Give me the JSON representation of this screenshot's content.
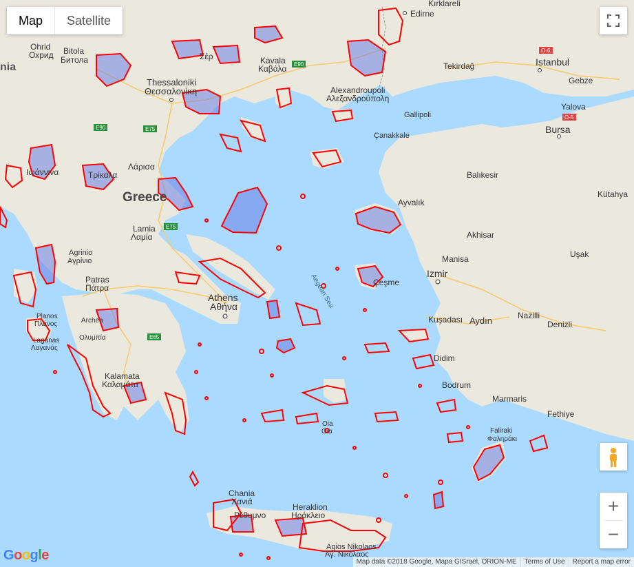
{
  "map_type": {
    "map": "Map",
    "satellite": "Satellite"
  },
  "labels": {
    "edirne": "Edirne",
    "kirklareli": "Kırklareli",
    "ohrid": "Ohrid",
    "ohrid_cyr": "Охрид",
    "bitola": "Bitola",
    "bitola_cyr": "Битола",
    "serres_partial": "Σέρ",
    "kavala": "Kavala",
    "kavala_gr": "Καβάλα",
    "thessaloniki": "Thessaloniki",
    "thessaloniki_gr": "Θεσσαλονίκη",
    "alexandroupoli": "Alexandroupoli",
    "alexandroupoli_gr": "Αλεξανδρούπολη",
    "tekirdag": "Tekirdağ",
    "istanbul": "Istanbul",
    "gebze": "Gebze",
    "yalova": "Yalova",
    "bursa": "Bursa",
    "gallipoli": "Gallipoli",
    "canakkale": "Çanakkale",
    "balikesir": "Balıkesir",
    "kutahya": "Kütahya",
    "ioannina_gr": "Ιωάννινα",
    "trikala_gr": "Τρίκαλα",
    "larissa_gr": "Λάρισα",
    "greece": "Greece",
    "lamia": "Lamia",
    "lamia_gr": "Λαμία",
    "ayvalik": "Ayvalık",
    "akhisar": "Akhisar",
    "manisa": "Manisa",
    "usak": "Uşak",
    "izmir": "Izmir",
    "cesme": "Çeşme",
    "agrinio": "Agrinio",
    "agrinio_gr": "Αγρίνιο",
    "patras": "Patras",
    "patras_gr": "Πάτρα",
    "athens": "Athens",
    "athens_gr": "Αθήνα",
    "aegean_sea": "Aegean Sea",
    "kusadasi": "Kuşadası",
    "aydin": "Aydın",
    "nazilli": "Nazilli",
    "denizli": "Denizli",
    "planos": "Planos",
    "planos_gr": "Πλάνος",
    "laganas": "Laganas",
    "laganas_gr": "Λαγανάς",
    "archea": "Archea",
    "olympia_gr": "Ολυμπία",
    "didim": "Didim",
    "bodrum": "Bodrum",
    "marmaris": "Marmaris",
    "fethiye": "Fethiye",
    "kalamata": "Kalamata",
    "kalamata_gr": "Καλαμάτα",
    "oia": "Oia",
    "oia_gr": "Οία",
    "faliraki": "Faliraki",
    "faliraki_gr": "Φαληράκι",
    "chania": "Chania",
    "chania_gr": "Χανιά",
    "rethymno_gr": "Ρέθυμνο",
    "heraklion": "Heraklion",
    "heraklion_gr": "Ηράκλειο",
    "agios_nikolaos": "Agios Nikolaos",
    "agios_nikolaos_gr": "Αγ. Νικόλαος",
    "albania_partial": "nia"
  },
  "road_shields": [
    "E90",
    "E75",
    "E90",
    "E65",
    "E75",
    "E90",
    "O-6",
    "O-5"
  ],
  "google_logo": "Google",
  "footer": {
    "map_data": "Map data ©2018 Google, Mapa GISrael, ORION-ME",
    "terms": "Terms of Use",
    "report": "Report a map error"
  },
  "controls": {
    "fullscreen_icon": "fullscreen-icon",
    "zoom_in": "+",
    "zoom_out": "−",
    "pegman_icon": "pegman-icon"
  },
  "colors": {
    "sea": "#aadaff",
    "land": "#ebe8de",
    "region_stroke": "#ff0000",
    "region_fill": "#7b8fe0"
  }
}
